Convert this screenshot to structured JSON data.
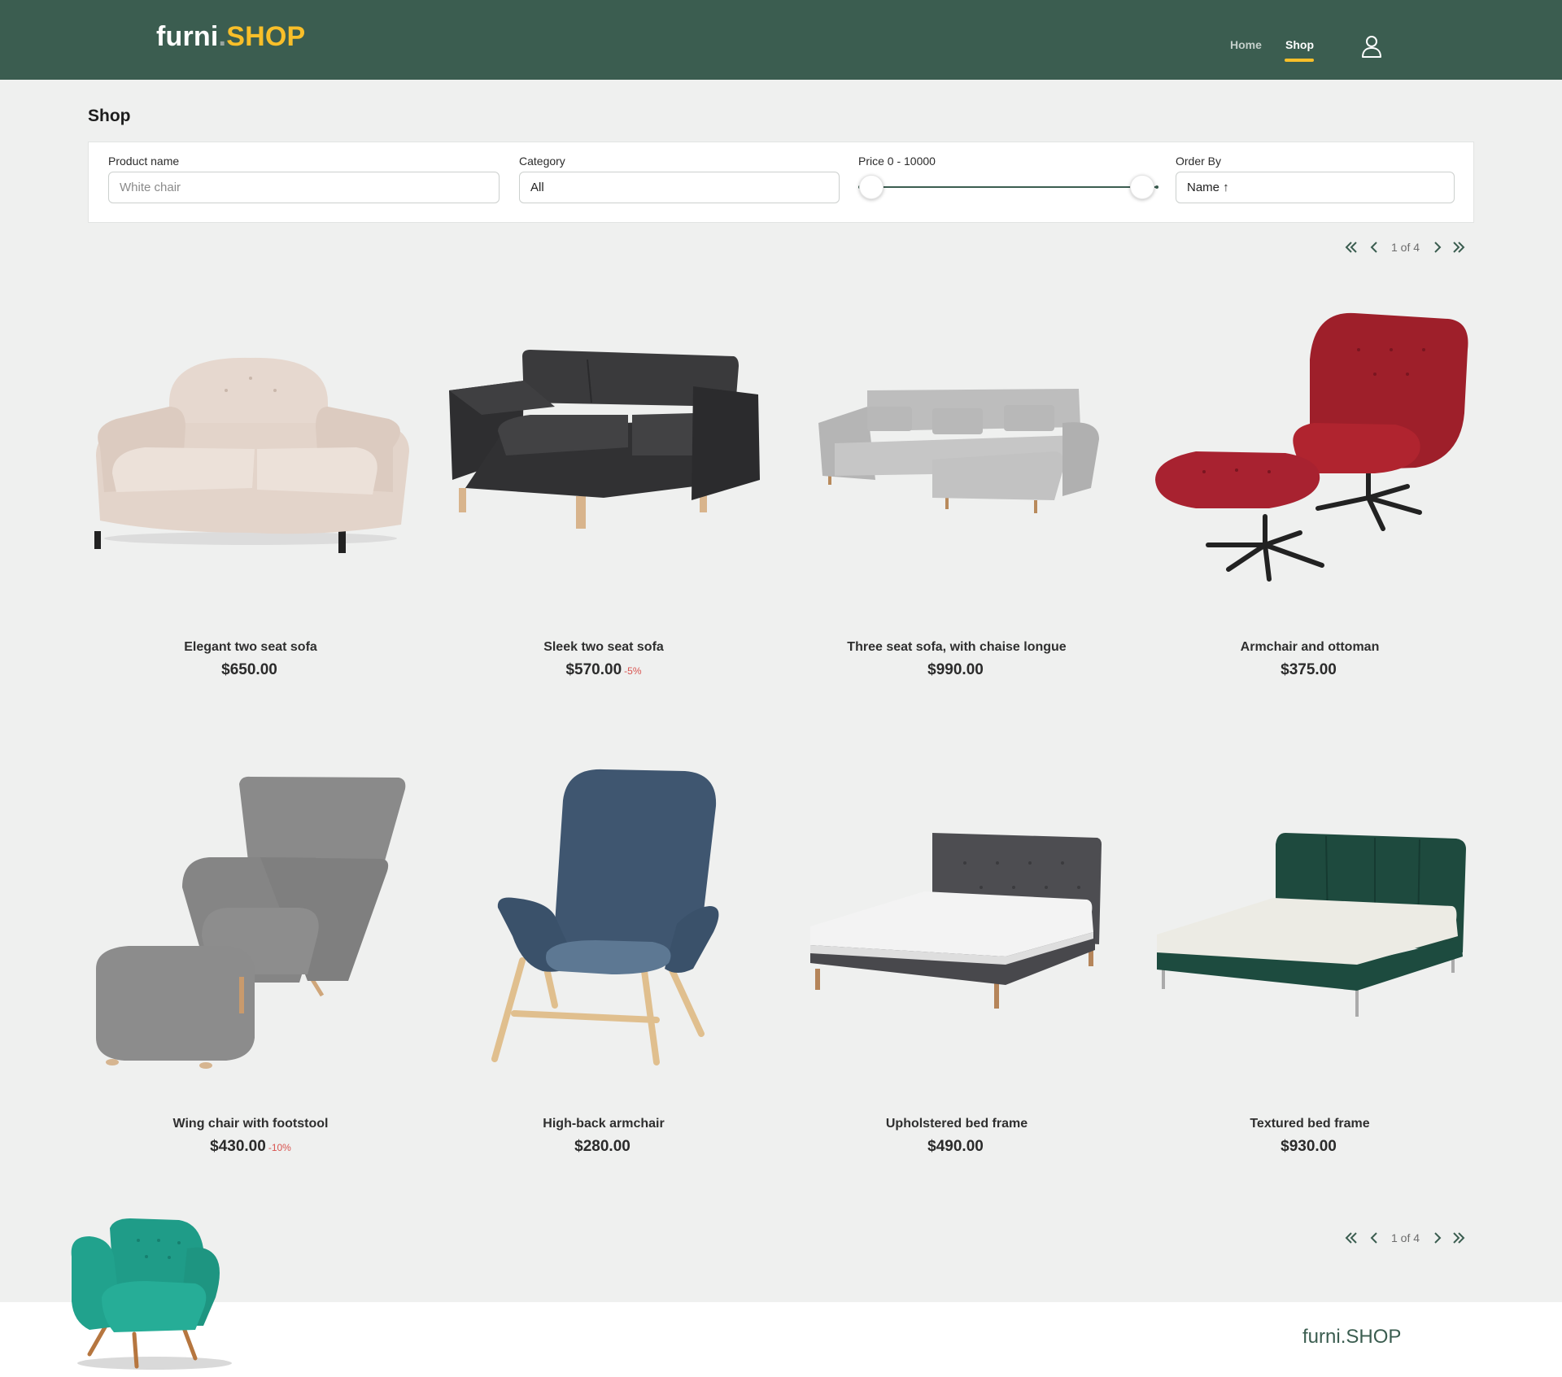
{
  "header": {
    "logo_main": "furni",
    "logo_dot": ".",
    "logo_accent": "SHOP",
    "nav": [
      {
        "label": "Home",
        "active": false
      },
      {
        "label": "Shop",
        "active": true
      }
    ],
    "user_icon": "user-icon"
  },
  "page": {
    "title": "Shop"
  },
  "filters": {
    "product_name": {
      "label": "Product name",
      "placeholder": "White chair",
      "value": ""
    },
    "category": {
      "label": "Category",
      "value": "All"
    },
    "price": {
      "label": "Price 0 - 10000",
      "min": 0,
      "max": 10000
    },
    "order_by": {
      "label": "Order By",
      "value": "Name ↑"
    }
  },
  "pagination": {
    "info": "1 of 4",
    "icons": [
      "first-page-icon",
      "prev-page-icon",
      "next-page-icon",
      "last-page-icon"
    ]
  },
  "products": [
    {
      "name": "Elegant two seat sofa",
      "price": "$650.00",
      "discount": ""
    },
    {
      "name": "Sleek two seat sofa",
      "price": "$570.00",
      "discount": "-5%"
    },
    {
      "name": "Three seat sofa, with chaise longue",
      "price": "$990.00",
      "discount": ""
    },
    {
      "name": "Armchair and ottoman",
      "price": "$375.00",
      "discount": ""
    },
    {
      "name": "Wing chair with footstool",
      "price": "$430.00",
      "discount": "-10%"
    },
    {
      "name": "High-back armchair",
      "price": "$280.00",
      "discount": ""
    },
    {
      "name": "Upholstered bed frame",
      "price": "$490.00",
      "discount": ""
    },
    {
      "name": "Textured bed frame",
      "price": "$930.00",
      "discount": ""
    }
  ],
  "footer": {
    "logo": "furni.SHOP"
  },
  "colors": {
    "brand_green": "#3b5d50",
    "accent_yellow": "#f9bf29",
    "background": "#eff0ef",
    "discount_red": "#d9534f"
  }
}
